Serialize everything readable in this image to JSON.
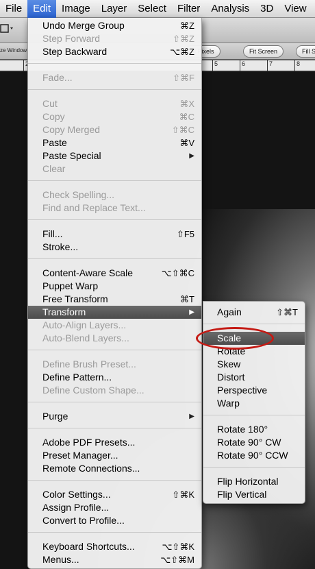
{
  "menubar": {
    "items": [
      "File",
      "Edit",
      "Image",
      "Layer",
      "Select",
      "Filter",
      "Analysis",
      "3D",
      "View"
    ]
  },
  "options_bar": {
    "left_text": "ze Window",
    "buttons": [
      "al Pixels",
      "Fit Screen",
      "Fill S"
    ]
  },
  "ruler": {
    "ticks": [
      "2",
      "5",
      "6",
      "7",
      "8"
    ]
  },
  "edit_menu": {
    "items": [
      {
        "label": "Undo Merge Group",
        "shortcut": "⌘Z",
        "enabled": true
      },
      {
        "label": "Step Forward",
        "shortcut": "⇧⌘Z",
        "enabled": false
      },
      {
        "label": "Step Backward",
        "shortcut": "⌥⌘Z",
        "enabled": true
      },
      {
        "label": "Fade...",
        "shortcut": "⇧⌘F",
        "enabled": false
      },
      {
        "label": "Cut",
        "shortcut": "⌘X",
        "enabled": false
      },
      {
        "label": "Copy",
        "shortcut": "⌘C",
        "enabled": false
      },
      {
        "label": "Copy Merged",
        "shortcut": "⇧⌘C",
        "enabled": false
      },
      {
        "label": "Paste",
        "shortcut": "⌘V",
        "enabled": true
      },
      {
        "label": "Paste Special",
        "shortcut": "",
        "enabled": true,
        "submenu": true
      },
      {
        "label": "Clear",
        "shortcut": "",
        "enabled": false
      },
      {
        "label": "Check Spelling...",
        "shortcut": "",
        "enabled": false
      },
      {
        "label": "Find and Replace Text...",
        "shortcut": "",
        "enabled": false
      },
      {
        "label": "Fill...",
        "shortcut": "⇧F5",
        "enabled": true
      },
      {
        "label": "Stroke...",
        "shortcut": "",
        "enabled": true
      },
      {
        "label": "Content-Aware Scale",
        "shortcut": "⌥⇧⌘C",
        "enabled": true
      },
      {
        "label": "Puppet Warp",
        "shortcut": "",
        "enabled": true
      },
      {
        "label": "Free Transform",
        "shortcut": "⌘T",
        "enabled": true
      },
      {
        "label": "Transform",
        "shortcut": "",
        "enabled": true,
        "submenu": true,
        "highlighted": true
      },
      {
        "label": "Auto-Align Layers...",
        "shortcut": "",
        "enabled": false
      },
      {
        "label": "Auto-Blend Layers...",
        "shortcut": "",
        "enabled": false
      },
      {
        "label": "Define Brush Preset...",
        "shortcut": "",
        "enabled": false
      },
      {
        "label": "Define Pattern...",
        "shortcut": "",
        "enabled": true
      },
      {
        "label": "Define Custom Shape...",
        "shortcut": "",
        "enabled": false
      },
      {
        "label": "Purge",
        "shortcut": "",
        "enabled": true,
        "submenu": true
      },
      {
        "label": "Adobe PDF Presets...",
        "shortcut": "",
        "enabled": true
      },
      {
        "label": "Preset Manager...",
        "shortcut": "",
        "enabled": true
      },
      {
        "label": "Remote Connections...",
        "shortcut": "",
        "enabled": true
      },
      {
        "label": "Color Settings...",
        "shortcut": "⇧⌘K",
        "enabled": true
      },
      {
        "label": "Assign Profile...",
        "shortcut": "",
        "enabled": true
      },
      {
        "label": "Convert to Profile...",
        "shortcut": "",
        "enabled": true
      },
      {
        "label": "Keyboard Shortcuts...",
        "shortcut": "⌥⇧⌘K",
        "enabled": true
      },
      {
        "label": "Menus...",
        "shortcut": "⌥⇧⌘M",
        "enabled": true
      }
    ]
  },
  "transform_submenu": {
    "items": [
      {
        "label": "Again",
        "shortcut": "⇧⌘T"
      },
      {
        "label": "Scale",
        "shortcut": "",
        "highlighted": true
      },
      {
        "label": "Rotate",
        "shortcut": ""
      },
      {
        "label": "Skew",
        "shortcut": ""
      },
      {
        "label": "Distort",
        "shortcut": ""
      },
      {
        "label": "Perspective",
        "shortcut": ""
      },
      {
        "label": "Warp",
        "shortcut": ""
      },
      {
        "label": "Rotate 180°",
        "shortcut": ""
      },
      {
        "label": "Rotate 90° CW",
        "shortcut": ""
      },
      {
        "label": "Rotate 90° CCW",
        "shortcut": ""
      },
      {
        "label": "Flip Horizontal",
        "shortcut": ""
      },
      {
        "label": "Flip Vertical",
        "shortcut": ""
      }
    ]
  },
  "colors": {
    "menubar_active": "#2a62d0",
    "menu_highlight": "#555555",
    "annotation_circle": "#c41a14"
  }
}
